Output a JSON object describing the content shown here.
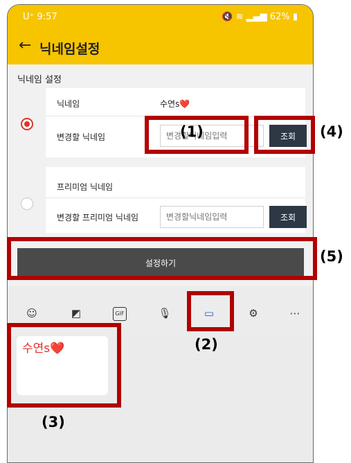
{
  "status_bar": {
    "time": "9:57",
    "carrier": "U⁺",
    "battery": "62%"
  },
  "app_bar": {
    "back_icon": "arrow-left-icon",
    "title": "닉네임설정"
  },
  "section_title": "닉네임 설정",
  "normal": {
    "nickname_label": "닉네임",
    "nickname_value": "수연s❤️",
    "change_label": "변경할 닉네임",
    "input_placeholder": "변경할닉네임입력",
    "lookup_label": "조회"
  },
  "premium": {
    "nickname_label": "프리미엄 닉네임",
    "change_label": "변경할 프리미엄 닉네임",
    "input_placeholder": "변경할닉네임입력",
    "lookup_label": "조회"
  },
  "submit_label": "설정하기",
  "keyboard_toolbar": [
    "emoji-icon",
    "sticker-icon",
    "gif-icon",
    "mic-icon",
    "clipboard-icon",
    "gear-icon",
    "more-icon"
  ],
  "gif_label": "GIF",
  "clipboard_item": "수연s❤️",
  "annotations": {
    "a1": "(1)",
    "a2": "(2)",
    "a3": "(3)",
    "a4": "(4)",
    "a5": "(5)"
  },
  "colors": {
    "app_bar": "#f7c400",
    "accent_red": "#e0322b",
    "lookup_button": "#2e3845",
    "submit_button": "#4a4a4a",
    "annotation_box": "#b30000"
  }
}
